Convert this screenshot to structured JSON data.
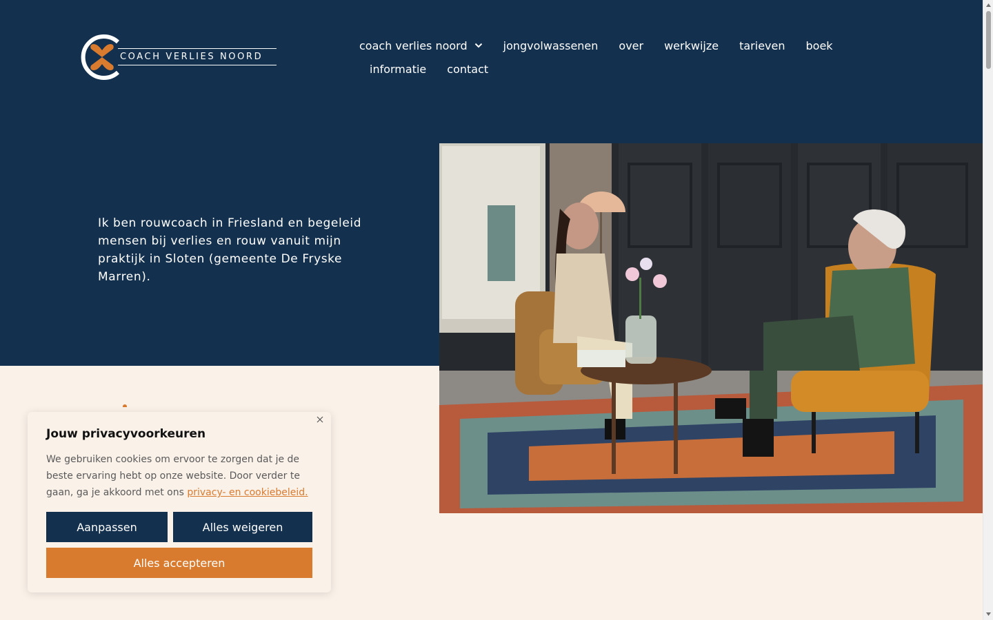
{
  "logo": {
    "text": "COACH VERLIES NOORD",
    "icon": "hourglass-heart-logo-icon"
  },
  "nav": {
    "row1": [
      "coach verlies noord",
      "jongvolwassenen",
      "over",
      "werkwijze",
      "tarieven",
      "boek"
    ],
    "row2": [
      "informatie",
      "contact"
    ],
    "dropdown_icon": "chevron-down-icon"
  },
  "hero": {
    "text": "Ik ben rouwcoach in Friesland en begeleid mensen bij verlies en rouw vanuit mijn praktijk in Sloten (gemeente De Fryske Marren)."
  },
  "cookie": {
    "title": "Jouw privacyvoorkeuren",
    "body": "We gebruiken cookies om ervoor te zorgen dat je de beste ervaring hebt op onze website. Door verder te gaan, ga je akkoord met ons",
    "link": "privacy- en cookiebeleid.",
    "customize": "Aanpassen",
    "reject": "Alles weigeren",
    "accept": "Alles accepteren",
    "close_icon": "close-icon"
  },
  "colors": {
    "navy": "#13304e",
    "orange": "#d97b2f",
    "cream": "#faf1e9"
  }
}
